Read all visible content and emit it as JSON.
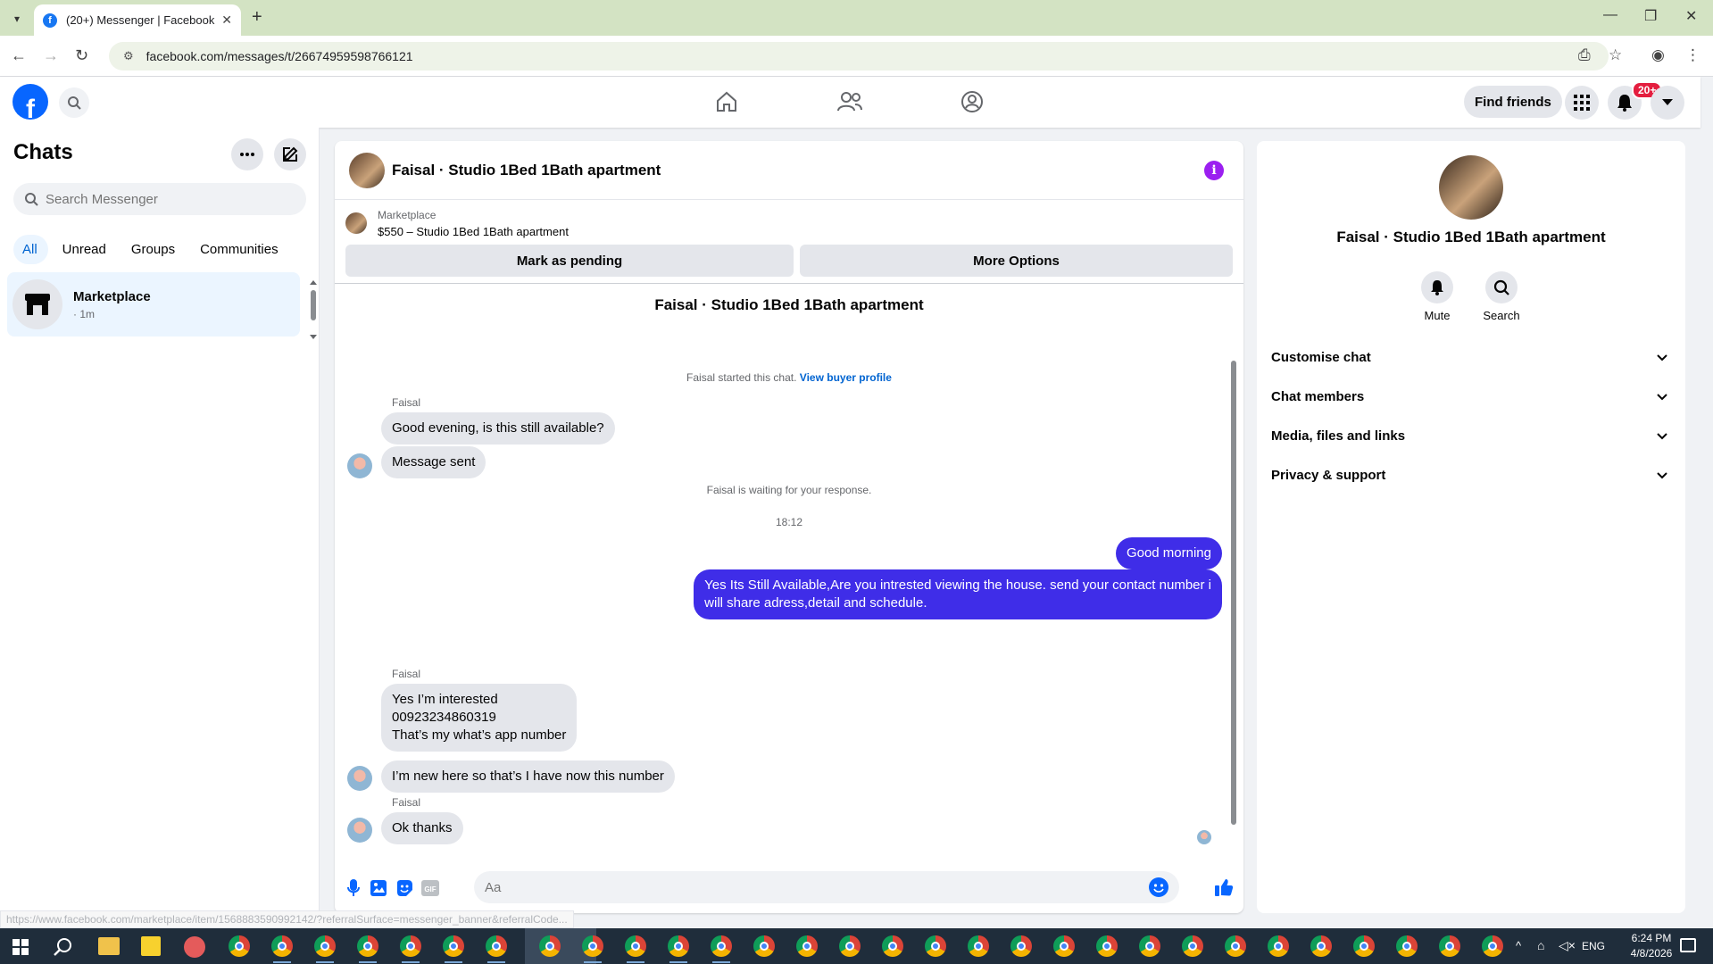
{
  "browser": {
    "tab_title": "(20+) Messenger | Facebook",
    "url": "facebook.com/messages/t/26674959598766121"
  },
  "header": {
    "find_friends": "Find friends",
    "notif_badge": "20+"
  },
  "sidebar": {
    "title": "Chats",
    "search_placeholder": "Search Messenger",
    "filters": [
      "All",
      "Unread",
      "Groups",
      "Communities"
    ],
    "chat_item": {
      "name": "Marketplace",
      "time": "· 1m"
    }
  },
  "chat": {
    "title": "Faisal · Studio 1Bed 1Bath apartment",
    "marketplace_label": "Marketplace",
    "listing": "$550 – Studio 1Bed 1Bath apartment",
    "btn_pending": "Mark as pending",
    "btn_more": "More Options",
    "conv_title": "Faisal · Studio 1Bed 1Bath apartment",
    "started": "Faisal started this chat.",
    "view_profile": "View buyer profile",
    "sender": "Faisal",
    "msg1": "Good evening, is this still available?",
    "msg2": "Message sent",
    "waiting": "Faisal is waiting for your response.",
    "time": "18:12",
    "out1": "Good morning",
    "out2_line1": "Yes Its Still Available,Are you intrested viewing the house. send your contact number i",
    "out2_line2": "will share adress,detail and schedule.",
    "in3_line1": "Yes I’m interested",
    "in3_line2": "00923234860319",
    "in3_line3": "That’s my what’s app number",
    "in4": "I’m new here so that’s I have now this number",
    "in5": "Ok thanks",
    "composer_placeholder": "Aa"
  },
  "right_panel": {
    "name": "Faisal · Studio 1Bed 1Bath apartment",
    "mute": "Mute",
    "search": "Search",
    "rows": [
      "Customise chat",
      "Chat members",
      "Media, files and links",
      "Privacy & support"
    ]
  },
  "status_url": "https://www.facebook.com/marketplace/item/1568883590992142/?referralSurface=messenger_banner&referralCode...",
  "taskbar": {
    "lang": "ENG",
    "clock_time": "6:24 PM",
    "clock_date": "4/8/2026"
  },
  "colors": {
    "fb_blue": "#0866ff",
    "outgoing_bubble": "#3f2de8",
    "incoming_bubble": "#e4e6eb",
    "info_purple": "#9b1ff0"
  }
}
